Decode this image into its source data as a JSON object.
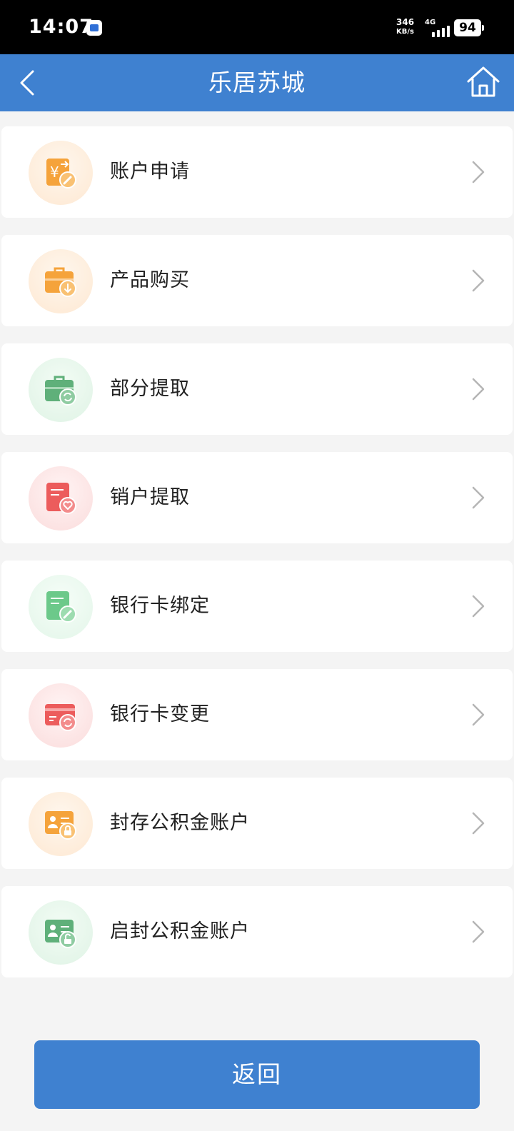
{
  "status_bar": {
    "time": "14:07",
    "net_speed_value": "346",
    "net_speed_unit": "KB/s",
    "network_type": "4G",
    "battery": "94"
  },
  "header": {
    "title": "乐居苏城",
    "back_icon": "chevron-left-icon",
    "home_icon": "home-icon"
  },
  "menu": {
    "items": [
      {
        "label": "账户申请",
        "icon": "yuan-exchange-icon",
        "accent": "#f5a33b",
        "bg": "#fdeedd"
      },
      {
        "label": "产品购买",
        "icon": "briefcase-download-icon",
        "accent": "#f5a33b",
        "bg": "#fdeedd"
      },
      {
        "label": "部分提取",
        "icon": "briefcase-refresh-icon",
        "accent": "#5fb07a",
        "bg": "#e6f6ea"
      },
      {
        "label": "销户提取",
        "icon": "document-heart-icon",
        "accent": "#ec5c5c",
        "bg": "#fde3e3"
      },
      {
        "label": "银行卡绑定",
        "icon": "document-edit-icon",
        "accent": "#6cc98a",
        "bg": "#e8f7ed"
      },
      {
        "label": "银行卡变更",
        "icon": "card-refresh-icon",
        "accent": "#ec5c5c",
        "bg": "#fde3e3"
      },
      {
        "label": "封存公积金账户",
        "icon": "id-card-lock-icon",
        "accent": "#f5a33b",
        "bg": "#fdeedd"
      },
      {
        "label": "启封公积金账户",
        "icon": "id-card-unlock-icon",
        "accent": "#5fb07a",
        "bg": "#e6f6ea"
      }
    ]
  },
  "footer": {
    "return_label": "返回"
  }
}
